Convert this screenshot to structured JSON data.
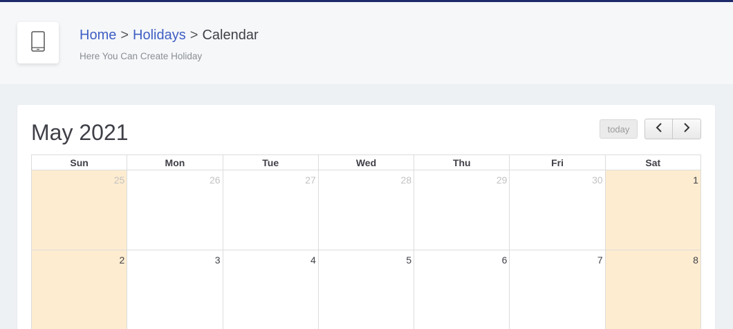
{
  "breadcrumb": {
    "home": "Home",
    "sep1": ">",
    "holidays": "Holidays",
    "sep2": ">",
    "current": "Calendar"
  },
  "subtitle": "Here You Can Create Holiday",
  "header_icon": "mobile-phone-icon",
  "calendar": {
    "title": "May 2021",
    "today_label": "today",
    "prev_icon": "chevron-left-icon",
    "next_icon": "chevron-right-icon",
    "weekdays": [
      "Sun",
      "Mon",
      "Tue",
      "Wed",
      "Thu",
      "Fri",
      "Sat"
    ],
    "weeks": [
      [
        "25",
        "26",
        "27",
        "28",
        "29",
        "30",
        "1"
      ],
      [
        "2",
        "3",
        "4",
        "5",
        "6",
        "7",
        "8"
      ]
    ],
    "weekend_color": "#feecd0"
  },
  "colors": {
    "accent_link": "#3f5fc4",
    "top_strip": "#1f2a6b"
  }
}
